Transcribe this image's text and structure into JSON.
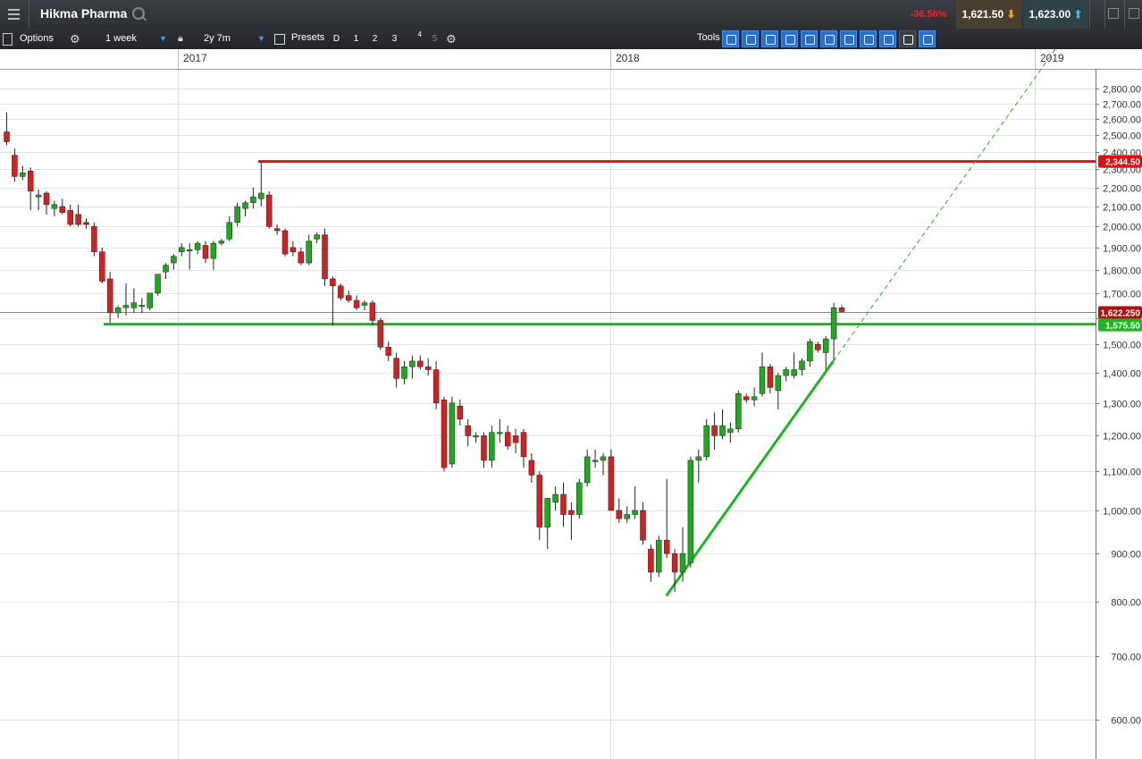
{
  "header": {
    "title": "Hikma Pharma",
    "change": "-36.56%",
    "sell_price": "1,621.50",
    "buy_price": "1,623.00"
  },
  "toolbar": {
    "options_label": "Options",
    "interval": "1 week",
    "range": "2y 7m",
    "presets_label": "Presets",
    "preset_buttons": [
      "D",
      "1",
      "2",
      "3",
      "4",
      "5"
    ],
    "tools_label": "Tools"
  },
  "colors": {
    "bull": "#1fa81f",
    "bear": "#d42020",
    "resistance": "#e01010",
    "support": "#1fb71f"
  },
  "chart_data": {
    "type": "candlestick",
    "instrument": "Hikma Pharma",
    "timeframe": "1 week",
    "y_scale": "log",
    "ylim": [
      545,
      2920
    ],
    "y_ticks": [
      600,
      700,
      800,
      900,
      1000,
      1100,
      1200,
      1300,
      1400,
      1500,
      1600,
      1700,
      1800,
      1900,
      2000,
      2100,
      2200,
      2300,
      2400,
      2500,
      2600,
      2700,
      2800
    ],
    "y_tick_labels": [
      "600.00",
      "700.00",
      "800.00",
      "900.00",
      "1,000.00",
      "1,100.00",
      "1,200.00",
      "1,300.00",
      "1,400.00",
      "1,500.00",
      "1,600.00",
      "1,700.00",
      "1,800.00",
      "1,900.00",
      "2,000.00",
      "2,100.00",
      "2,200.00",
      "2,300.00",
      "2,400.00",
      "2,500.00",
      "2,600.00",
      "2,700.00",
      "2,800.00"
    ],
    "x_labels": [
      "2017",
      "2018",
      "2019"
    ],
    "current_price": 1622.25,
    "current_price_label": "1,622.250",
    "levels": [
      {
        "name": "resistance",
        "value": 2344.5,
        "label": "2,344.50"
      },
      {
        "name": "support",
        "value": 1575.5,
        "label": "1,575.50"
      }
    ],
    "candles": [
      {
        "o": 2520,
        "h": 2640,
        "l": 2440,
        "c": 2460
      },
      {
        "o": 2380,
        "h": 2420,
        "l": 2230,
        "c": 2260
      },
      {
        "o": 2260,
        "h": 2320,
        "l": 2240,
        "c": 2280
      },
      {
        "o": 2290,
        "h": 2310,
        "l": 2080,
        "c": 2180
      },
      {
        "o": 2150,
        "h": 2190,
        "l": 2080,
        "c": 2160
      },
      {
        "o": 2170,
        "h": 2180,
        "l": 2060,
        "c": 2110
      },
      {
        "o": 2090,
        "h": 2130,
        "l": 2050,
        "c": 2110
      },
      {
        "o": 2100,
        "h": 2140,
        "l": 2060,
        "c": 2070
      },
      {
        "o": 2080,
        "h": 2110,
        "l": 2000,
        "c": 2010
      },
      {
        "o": 2060,
        "h": 2110,
        "l": 2000,
        "c": 2010
      },
      {
        "o": 2020,
        "h": 2040,
        "l": 1990,
        "c": 2010
      },
      {
        "o": 2000,
        "h": 2020,
        "l": 1860,
        "c": 1880
      },
      {
        "o": 1880,
        "h": 1900,
        "l": 1740,
        "c": 1750
      },
      {
        "o": 1760,
        "h": 1790,
        "l": 1580,
        "c": 1620
      },
      {
        "o": 1620,
        "h": 1650,
        "l": 1600,
        "c": 1640
      },
      {
        "o": 1640,
        "h": 1740,
        "l": 1610,
        "c": 1650
      },
      {
        "o": 1640,
        "h": 1720,
        "l": 1620,
        "c": 1660
      },
      {
        "o": 1650,
        "h": 1680,
        "l": 1620,
        "c": 1650
      },
      {
        "o": 1640,
        "h": 1700,
        "l": 1630,
        "c": 1700
      },
      {
        "o": 1700,
        "h": 1780,
        "l": 1690,
        "c": 1780
      },
      {
        "o": 1790,
        "h": 1830,
        "l": 1760,
        "c": 1820
      },
      {
        "o": 1830,
        "h": 1870,
        "l": 1800,
        "c": 1860
      },
      {
        "o": 1880,
        "h": 1920,
        "l": 1860,
        "c": 1900
      },
      {
        "o": 1890,
        "h": 1920,
        "l": 1800,
        "c": 1890
      },
      {
        "o": 1890,
        "h": 1930,
        "l": 1870,
        "c": 1920
      },
      {
        "o": 1910,
        "h": 1930,
        "l": 1830,
        "c": 1850
      },
      {
        "o": 1850,
        "h": 1930,
        "l": 1800,
        "c": 1920
      },
      {
        "o": 1920,
        "h": 1940,
        "l": 1910,
        "c": 1930
      },
      {
        "o": 1940,
        "h": 2050,
        "l": 1930,
        "c": 2020
      },
      {
        "o": 2020,
        "h": 2120,
        "l": 2000,
        "c": 2100
      },
      {
        "o": 2090,
        "h": 2130,
        "l": 2050,
        "c": 2120
      },
      {
        "o": 2120,
        "h": 2200,
        "l": 2090,
        "c": 2150
      },
      {
        "o": 2140,
        "h": 2340,
        "l": 2100,
        "c": 2170
      },
      {
        "o": 2160,
        "h": 2180,
        "l": 1990,
        "c": 2000
      },
      {
        "o": 1990,
        "h": 2010,
        "l": 1960,
        "c": 1980
      },
      {
        "o": 1980,
        "h": 1990,
        "l": 1860,
        "c": 1870
      },
      {
        "o": 1900,
        "h": 1930,
        "l": 1860,
        "c": 1880
      },
      {
        "o": 1880,
        "h": 1900,
        "l": 1820,
        "c": 1830
      },
      {
        "o": 1830,
        "h": 1960,
        "l": 1820,
        "c": 1930
      },
      {
        "o": 1940,
        "h": 1970,
        "l": 1920,
        "c": 1960
      },
      {
        "o": 1960,
        "h": 1990,
        "l": 1730,
        "c": 1760
      },
      {
        "o": 1760,
        "h": 1770,
        "l": 1570,
        "c": 1730
      },
      {
        "o": 1730,
        "h": 1740,
        "l": 1670,
        "c": 1680
      },
      {
        "o": 1690,
        "h": 1710,
        "l": 1660,
        "c": 1670
      },
      {
        "o": 1670,
        "h": 1690,
        "l": 1630,
        "c": 1640
      },
      {
        "o": 1650,
        "h": 1670,
        "l": 1630,
        "c": 1660
      },
      {
        "o": 1660,
        "h": 1670,
        "l": 1570,
        "c": 1590
      },
      {
        "o": 1590,
        "h": 1600,
        "l": 1480,
        "c": 1490
      },
      {
        "o": 1490,
        "h": 1510,
        "l": 1440,
        "c": 1460
      },
      {
        "o": 1450,
        "h": 1470,
        "l": 1350,
        "c": 1380
      },
      {
        "o": 1380,
        "h": 1440,
        "l": 1360,
        "c": 1420
      },
      {
        "o": 1420,
        "h": 1460,
        "l": 1380,
        "c": 1440
      },
      {
        "o": 1440,
        "h": 1460,
        "l": 1410,
        "c": 1420
      },
      {
        "o": 1420,
        "h": 1450,
        "l": 1390,
        "c": 1410
      },
      {
        "o": 1410,
        "h": 1440,
        "l": 1280,
        "c": 1300
      },
      {
        "o": 1310,
        "h": 1320,
        "l": 1100,
        "c": 1110
      },
      {
        "o": 1120,
        "h": 1320,
        "l": 1110,
        "c": 1300
      },
      {
        "o": 1290,
        "h": 1310,
        "l": 1230,
        "c": 1250
      },
      {
        "o": 1230,
        "h": 1250,
        "l": 1170,
        "c": 1200
      },
      {
        "o": 1200,
        "h": 1210,
        "l": 1180,
        "c": 1200
      },
      {
        "o": 1200,
        "h": 1210,
        "l": 1110,
        "c": 1130
      },
      {
        "o": 1130,
        "h": 1230,
        "l": 1110,
        "c": 1210
      },
      {
        "o": 1210,
        "h": 1250,
        "l": 1180,
        "c": 1210
      },
      {
        "o": 1210,
        "h": 1230,
        "l": 1160,
        "c": 1170
      },
      {
        "o": 1200,
        "h": 1220,
        "l": 1150,
        "c": 1180
      },
      {
        "o": 1210,
        "h": 1220,
        "l": 1110,
        "c": 1140
      },
      {
        "o": 1130,
        "h": 1150,
        "l": 1070,
        "c": 1090
      },
      {
        "o": 1090,
        "h": 1100,
        "l": 930,
        "c": 960
      },
      {
        "o": 960,
        "h": 1030,
        "l": 910,
        "c": 1030
      },
      {
        "o": 1020,
        "h": 1060,
        "l": 1000,
        "c": 1040
      },
      {
        "o": 1040,
        "h": 1070,
        "l": 960,
        "c": 990
      },
      {
        "o": 1000,
        "h": 1020,
        "l": 930,
        "c": 990
      },
      {
        "o": 990,
        "h": 1080,
        "l": 980,
        "c": 1070
      },
      {
        "o": 1070,
        "h": 1160,
        "l": 1060,
        "c": 1140
      },
      {
        "o": 1130,
        "h": 1160,
        "l": 1110,
        "c": 1130
      },
      {
        "o": 1130,
        "h": 1150,
        "l": 1090,
        "c": 1140
      },
      {
        "o": 1140,
        "h": 1160,
        "l": 1040,
        "c": 1000
      },
      {
        "o": 1000,
        "h": 1030,
        "l": 970,
        "c": 980
      },
      {
        "o": 980,
        "h": 1010,
        "l": 970,
        "c": 990
      },
      {
        "o": 990,
        "h": 1060,
        "l": 980,
        "c": 1000
      },
      {
        "o": 1000,
        "h": 1020,
        "l": 920,
        "c": 930
      },
      {
        "o": 910,
        "h": 920,
        "l": 840,
        "c": 860
      },
      {
        "o": 860,
        "h": 940,
        "l": 850,
        "c": 930
      },
      {
        "o": 930,
        "h": 1080,
        "l": 890,
        "c": 900
      },
      {
        "o": 900,
        "h": 910,
        "l": 820,
        "c": 860
      },
      {
        "o": 860,
        "h": 960,
        "l": 840,
        "c": 900
      },
      {
        "o": 880,
        "h": 1140,
        "l": 870,
        "c": 1130
      },
      {
        "o": 1130,
        "h": 1160,
        "l": 1070,
        "c": 1140
      },
      {
        "o": 1140,
        "h": 1250,
        "l": 1130,
        "c": 1230
      },
      {
        "o": 1230,
        "h": 1270,
        "l": 1160,
        "c": 1200
      },
      {
        "o": 1200,
        "h": 1280,
        "l": 1190,
        "c": 1230
      },
      {
        "o": 1210,
        "h": 1240,
        "l": 1180,
        "c": 1220
      },
      {
        "o": 1220,
        "h": 1340,
        "l": 1210,
        "c": 1330
      },
      {
        "o": 1320,
        "h": 1330,
        "l": 1300,
        "c": 1310
      },
      {
        "o": 1310,
        "h": 1350,
        "l": 1290,
        "c": 1320
      },
      {
        "o": 1330,
        "h": 1470,
        "l": 1320,
        "c": 1420
      },
      {
        "o": 1420,
        "h": 1430,
        "l": 1330,
        "c": 1350
      },
      {
        "o": 1340,
        "h": 1400,
        "l": 1280,
        "c": 1390
      },
      {
        "o": 1390,
        "h": 1420,
        "l": 1370,
        "c": 1410
      },
      {
        "o": 1390,
        "h": 1470,
        "l": 1380,
        "c": 1410
      },
      {
        "o": 1410,
        "h": 1450,
        "l": 1390,
        "c": 1440
      },
      {
        "o": 1440,
        "h": 1520,
        "l": 1420,
        "c": 1510
      },
      {
        "o": 1500,
        "h": 1510,
        "l": 1470,
        "c": 1480
      },
      {
        "o": 1470,
        "h": 1530,
        "l": 1410,
        "c": 1520
      },
      {
        "o": 1520,
        "h": 1660,
        "l": 1440,
        "c": 1640
      },
      {
        "o": 1640,
        "h": 1650,
        "l": 1620,
        "c": 1625
      }
    ]
  }
}
